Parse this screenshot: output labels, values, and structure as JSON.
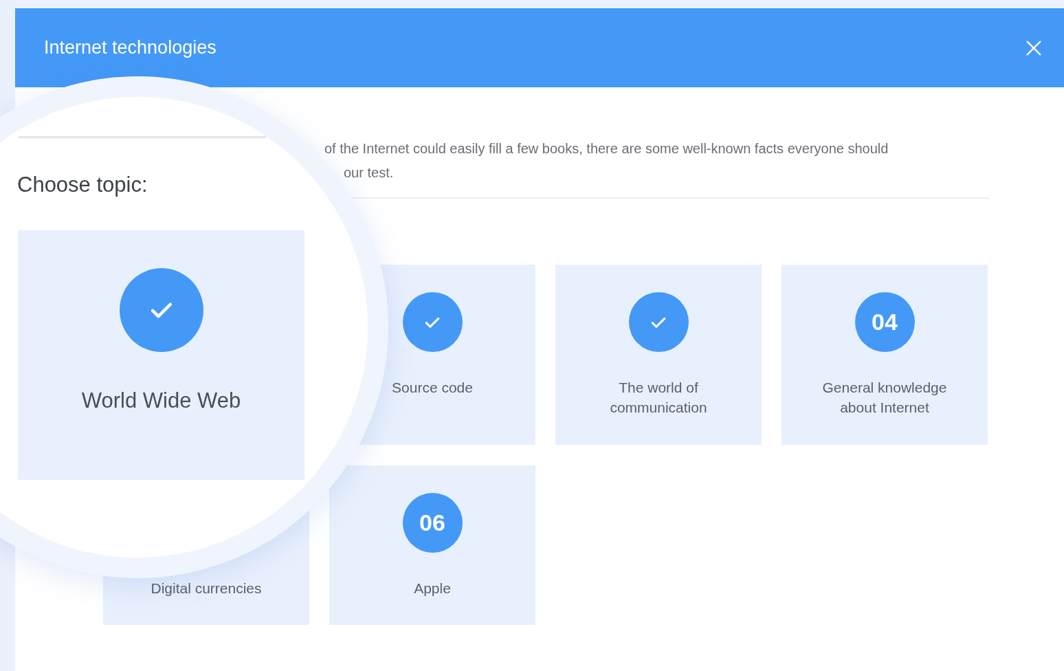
{
  "dialog": {
    "title": "Internet technologies"
  },
  "intro": [
    "of the Internet could easily fill a few books, there are some well-known facts everyone should",
    "our test."
  ],
  "magnifier": {
    "heading": "Choose topic:",
    "topic": {
      "label": "World Wide Web",
      "kind": "check"
    }
  },
  "topics": [
    {
      "label": "Source code",
      "kind": "check"
    },
    {
      "label": "The world of communication",
      "kind": "check"
    },
    {
      "label": "General knowledge about Internet",
      "kind": "number",
      "number": "04"
    },
    {
      "label": "Digital currencies",
      "kind": "covered"
    },
    {
      "label": "Apple",
      "kind": "number",
      "number": "06"
    }
  ]
}
